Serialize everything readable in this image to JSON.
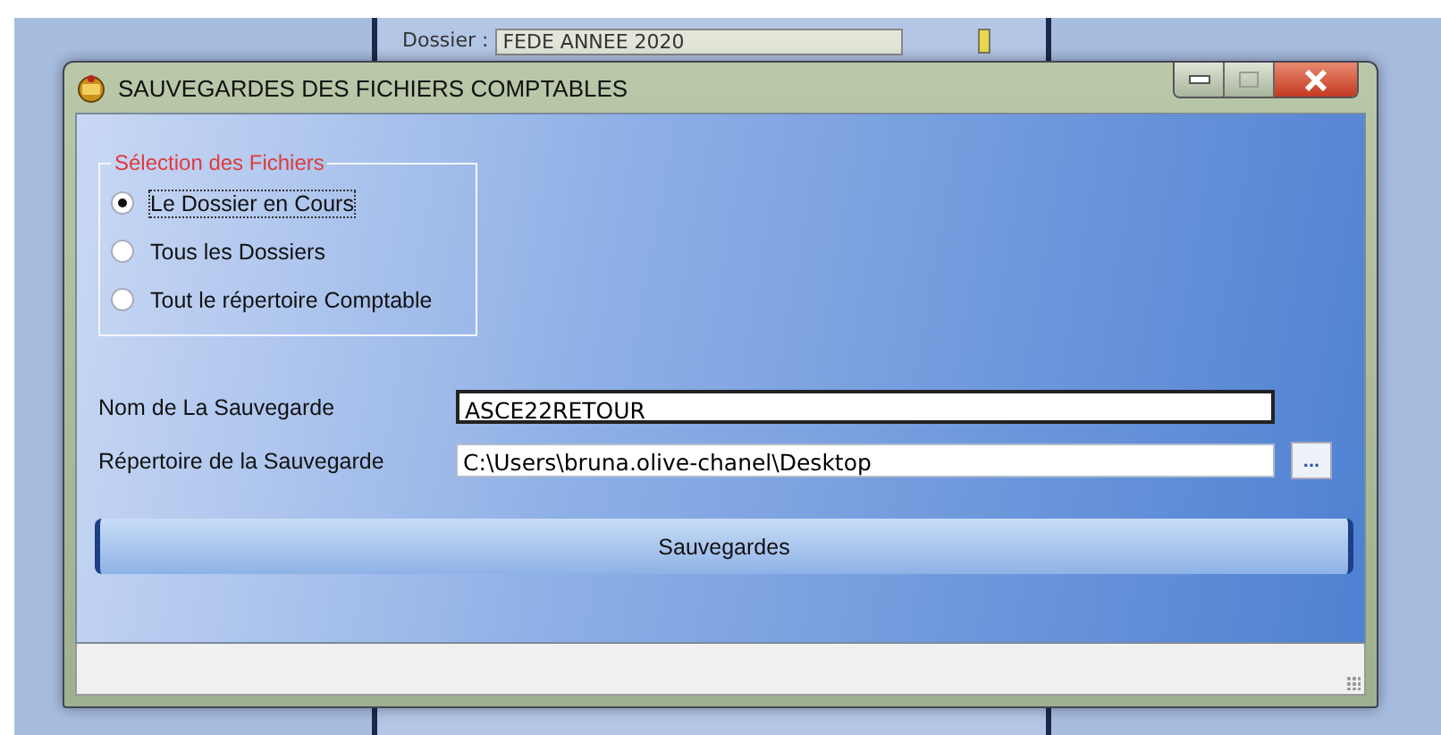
{
  "background_window": {
    "label": "Dossier :",
    "value": "FEDE ANNEE 2020"
  },
  "window": {
    "title": "SAUVEGARDES DES FICHIERS COMPTABLES"
  },
  "group": {
    "title": "Sélection des Fichiers",
    "options": [
      {
        "label": "Le Dossier en Cours",
        "selected": true
      },
      {
        "label": "Tous les Dossiers",
        "selected": false
      },
      {
        "label": "Tout le répertoire Comptable",
        "selected": false
      }
    ]
  },
  "fields": [
    {
      "label": "Nom de La Sauvegarde",
      "value": "ASCE22RETOUR"
    },
    {
      "label": "Répertoire de la Sauvegarde",
      "value": "C:\\Users\\bruna.olive-chanel\\Desktop",
      "browse": "..."
    }
  ],
  "buttons": [
    "Sauvegardes"
  ]
}
